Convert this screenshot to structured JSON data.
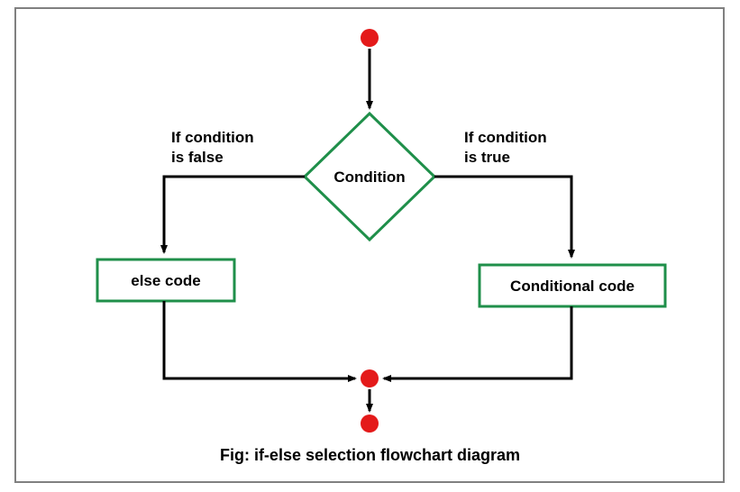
{
  "diagram": {
    "condition_label": "Condition",
    "false_branch_label_line1": "If condition",
    "false_branch_label_line2": "is false",
    "true_branch_label_line1": "If condition",
    "true_branch_label_line2": "is true",
    "else_box_label": "else code",
    "conditional_box_label": "Conditional code",
    "caption": "Fig: if-else selection flowchart diagram",
    "colors": {
      "green": "#1f8f4a",
      "red": "#e41a1a",
      "black": "#000000",
      "frame": "#808080"
    }
  }
}
